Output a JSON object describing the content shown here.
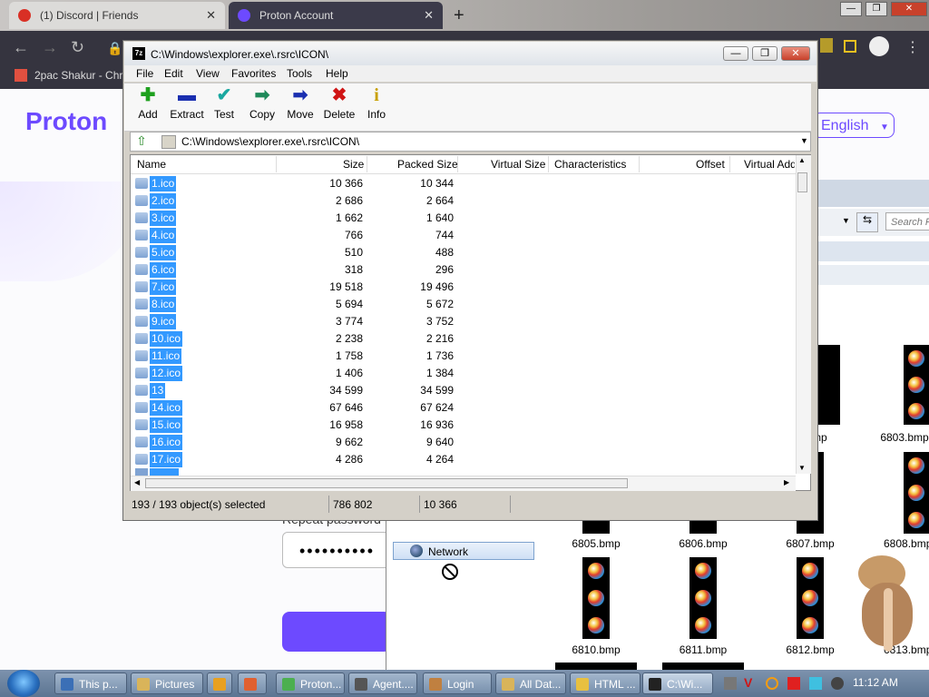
{
  "browser": {
    "tabs": [
      {
        "title": "(1) Discord | Friends",
        "active": false,
        "icon_color": "#d93025"
      },
      {
        "title": "Proton Account",
        "active": true,
        "icon_color": "#6d4aff"
      }
    ],
    "bookmark": "2pac Shakur - Chro"
  },
  "proton": {
    "logo": "Proton",
    "language": "English",
    "password_label": "Repeat password",
    "password_value": "••••••••••"
  },
  "explorer_bg": {
    "search_placeholder": "Search P",
    "network_label": "Network",
    "thumbnails_row1": [
      "6805.bmp",
      "6806.bmp",
      "6807.bmp",
      "6808.bmp"
    ],
    "thumbnails_row2": [
      "6810.bmp",
      "6811.bmp",
      "6812.bmp",
      "6813.bmp"
    ],
    "thumb_top_partial": "6803.bmp",
    "thumb_left_partial": "bmp"
  },
  "zip": {
    "title": "C:\\Windows\\explorer.exe\\.rsrc\\ICON\\",
    "logo": "7z",
    "menu": [
      "File",
      "Edit",
      "View",
      "Favorites",
      "Tools",
      "Help"
    ],
    "toolbar": [
      {
        "label": "Add",
        "icon": "plus-icon",
        "glyph": "✚",
        "color": "#1ea01e"
      },
      {
        "label": "Extract",
        "icon": "minus-icon",
        "glyph": "▬",
        "color": "#1a2fb0"
      },
      {
        "label": "Test",
        "icon": "check-icon",
        "glyph": "✔",
        "color": "#1aa8a0"
      },
      {
        "label": "Copy",
        "icon": "copy-arrow-icon",
        "glyph": "➡",
        "color": "#1e8a5a"
      },
      {
        "label": "Move",
        "icon": "move-arrow-icon",
        "glyph": "➡",
        "color": "#1a2fb0"
      },
      {
        "label": "Delete",
        "icon": "delete-x-icon",
        "glyph": "✖",
        "color": "#d01515"
      },
      {
        "label": "Info",
        "icon": "info-icon",
        "glyph": "i",
        "color": "#c8a000"
      }
    ],
    "path": "C:\\Windows\\explorer.exe\\.rsrc\\ICON\\",
    "columns": [
      "Name",
      "Size",
      "Packed Size",
      "Virtual Size",
      "Characteristics",
      "Offset",
      "Virtual Add"
    ],
    "rows": [
      {
        "name": "1.ico",
        "size": "10 366",
        "packed": "10 344"
      },
      {
        "name": "2.ico",
        "size": "2 686",
        "packed": "2 664"
      },
      {
        "name": "3.ico",
        "size": "1 662",
        "packed": "1 640"
      },
      {
        "name": "4.ico",
        "size": "766",
        "packed": "744"
      },
      {
        "name": "5.ico",
        "size": "510",
        "packed": "488"
      },
      {
        "name": "6.ico",
        "size": "318",
        "packed": "296"
      },
      {
        "name": "7.ico",
        "size": "19 518",
        "packed": "19 496"
      },
      {
        "name": "8.ico",
        "size": "5 694",
        "packed": "5 672"
      },
      {
        "name": "9.ico",
        "size": "3 774",
        "packed": "3 752"
      },
      {
        "name": "10.ico",
        "size": "2 238",
        "packed": "2 216"
      },
      {
        "name": "11.ico",
        "size": "1 758",
        "packed": "1 736"
      },
      {
        "name": "12.ico",
        "size": "1 406",
        "packed": "1 384"
      },
      {
        "name": "13",
        "size": "34 599",
        "packed": "34 599"
      },
      {
        "name": "14.ico",
        "size": "67 646",
        "packed": "67 624"
      },
      {
        "name": "15.ico",
        "size": "16 958",
        "packed": "16 936"
      },
      {
        "name": "16.ico",
        "size": "9 662",
        "packed": "9 640"
      },
      {
        "name": "17.ico",
        "size": "4 286",
        "packed": "4 264"
      }
    ],
    "status": {
      "selected": "193 / 193 object(s) selected",
      "total": "786 802",
      "item": "10 366"
    }
  },
  "taskbar": {
    "tasks": [
      {
        "label": "This p...",
        "icon_color": "#3b6fb6"
      },
      {
        "label": "Pictures",
        "icon_color": "#d9b45a"
      },
      {
        "label": "",
        "icon_color": "#e8a020"
      },
      {
        "label": "",
        "icon_color": "#e06030"
      },
      {
        "label": "Proton...",
        "icon_color": "#4caf50"
      },
      {
        "label": "Agent....",
        "icon_color": "#555555"
      },
      {
        "label": "Login",
        "icon_color": "#c08040"
      },
      {
        "label": "All Dat...",
        "icon_color": "#d9b45a"
      },
      {
        "label": "HTML ...",
        "icon_color": "#e8c040"
      },
      {
        "label": "C:\\Wi...",
        "icon_color": "#222222"
      }
    ],
    "clock": "11:12 AM"
  }
}
